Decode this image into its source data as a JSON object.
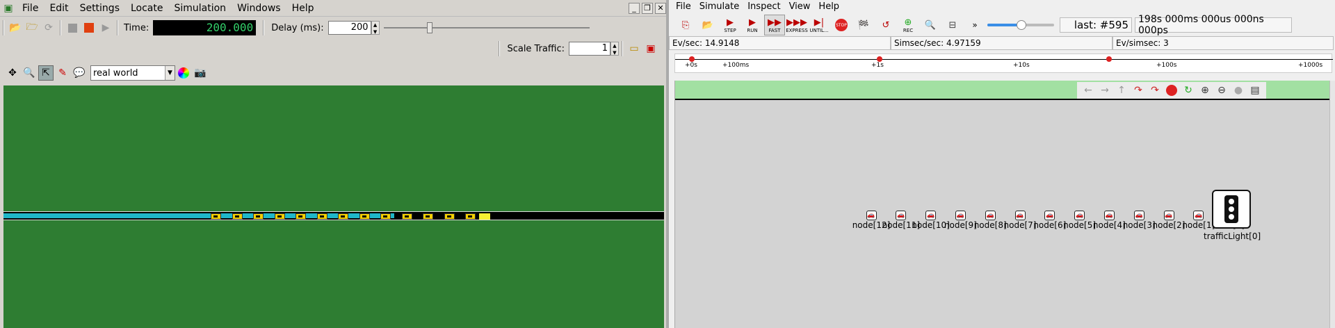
{
  "sumo": {
    "menu": [
      "File",
      "Edit",
      "Settings",
      "Locate",
      "Simulation",
      "Windows",
      "Help"
    ],
    "time_label": "Time:",
    "time_value": "200.000",
    "delay_label": "Delay (ms):",
    "delay_value": "200",
    "delay_slider_fraction": 0.22,
    "scale_label": "Scale Traffic:",
    "scale_value": "1",
    "view_scheme": "real world",
    "car_count": 13
  },
  "omnet": {
    "menu": [
      "File",
      "Simulate",
      "Inspect",
      "View",
      "Help"
    ],
    "toolbar": [
      "STEP",
      "RUN",
      "FAST",
      "EXPRESS",
      "UNTIL...",
      "STOP",
      "REC"
    ],
    "last_event": "last: #595",
    "sim_time": "198s 000ms 000us 000ns 000ps",
    "ev_per_sec": "Ev/sec: 14.9148",
    "simsec_per_sec": "Simsec/sec: 4.97159",
    "ev_per_simsec": "Ev/simsec: 3",
    "timeline_ticks": [
      "+0s",
      "+100ms",
      "+1s",
      "+10s",
      "+100s",
      "+1000s"
    ],
    "nodes": [
      "node[12]",
      "node[11]",
      "node[10]",
      "node[9]",
      "node[8]",
      "node[7]",
      "node[6]",
      "node[5]",
      "node[4]",
      "node[3]",
      "node[2]",
      "node[1]",
      "node[0]"
    ],
    "traffic_light": "trafficLight[0]"
  }
}
